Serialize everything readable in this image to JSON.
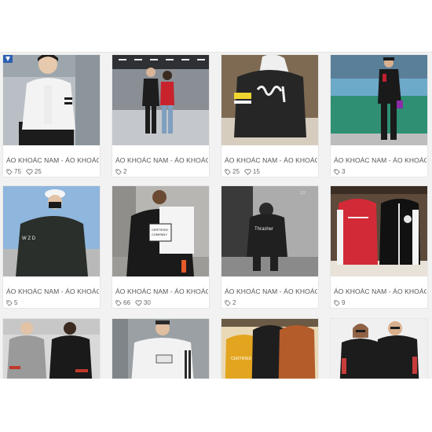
{
  "products": [
    {
      "title": "ÁO KHOÁC NAM - ÁO KHOÁC NAM",
      "tags": "75",
      "likes": "25",
      "image": "man in white jacket with dark stripe sitting",
      "colors": [
        "#b9bfc4",
        "#f3f3f3",
        "#1c1c1c"
      ]
    },
    {
      "title": "ÁO KHOÁC NAM - ÁO KHOÁC NAM",
      "tags": "2",
      "likes": "",
      "image": "couple standing in mall corridor, red jacket",
      "colors": [
        "#8a8f96",
        "#1d1d1d",
        "#c8232c"
      ]
    },
    {
      "title": "ÁO KHOÁC NAM - ÁO KHOÁC NAM",
      "tags": "25",
      "likes": "15",
      "image": "black hoodie with yellow 'Smile' lettering",
      "colors": [
        "#7e6a53",
        "#262626",
        "#f0d531"
      ]
    },
    {
      "title": "ÁO KHOÁC NAM - ÁO KHOÁC NAM",
      "tags": "3",
      "likes": "",
      "image": "man in black jacket standing on green wall street",
      "colors": [
        "#6da9c9",
        "#2e8f73",
        "#1a1a1a"
      ]
    },
    {
      "title": "ÁO KHOÁC NAM - ÁO KHOÁC NAM",
      "tags": "5",
      "likes": "",
      "image": "man in white cap and dark jacket, blue sky",
      "colors": [
        "#8fb6dd",
        "#2a2f2b",
        "#f5f5f5"
      ]
    },
    {
      "title": "ÁO KHOÁC NAM - ÁO KHOÁC NAM",
      "tags": "66",
      "likes": "30",
      "image": "back of white and black hoodie with print",
      "colors": [
        "#b7b6b2",
        "#1a1a1a",
        "#f4f4f4"
      ]
    },
    {
      "title": "ÁO KHOÁC NAM - ÁO KHOÁC NAM",
      "tags": "2",
      "likes": "",
      "image": "black and white photo, dark hoodie back",
      "colors": [
        "#d0d0d0",
        "#202020",
        "#6a6a6a"
      ]
    },
    {
      "title": "ÁO KHOÁC NAM - ÁO KHOÁC NAM",
      "tags": "9",
      "likes": "",
      "image": "red and black varsity hoodies on hangers",
      "colors": [
        "#5d4a3b",
        "#d32a37",
        "#111111"
      ]
    },
    {
      "title": "",
      "tags": "",
      "likes": "",
      "image": "couple in grey and black jackets with red stripes",
      "colors": [
        "#d9d9d9",
        "#9a9a9a",
        "#1a1a1a"
      ]
    },
    {
      "title": "",
      "tags": "",
      "likes": "",
      "image": "man in white striped hoodie",
      "colors": [
        "#9aa0a3",
        "#f2f2f2",
        "#2a2a2a"
      ]
    },
    {
      "title": "",
      "tags": "",
      "likes": "",
      "image": "yellow, black and orange hoodies hanging",
      "colors": [
        "#ead9b6",
        "#e3a51f",
        "#b45c2a"
      ]
    },
    {
      "title": "",
      "tags": "",
      "likes": "",
      "image": "couple in black jackets with red sleeves",
      "colors": [
        "#f0f0f0",
        "#1c1c1c",
        "#c83b3b"
      ]
    }
  ],
  "icons": {
    "tag": "tag-icon",
    "like": "heart-icon"
  }
}
